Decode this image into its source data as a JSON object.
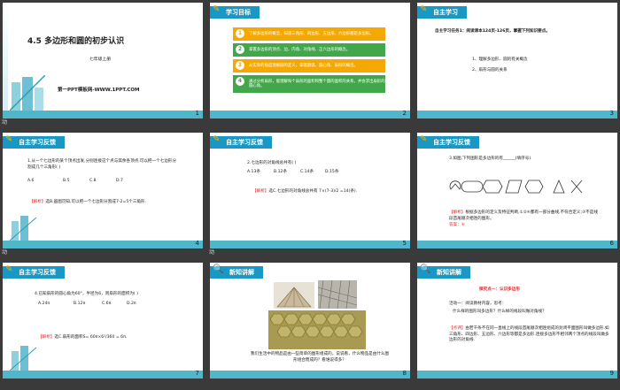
{
  "slides": [
    {
      "n": "1",
      "title": "4.5  多边形和圆的初步认识",
      "subtitle": "七年级上册",
      "credit": "第一PPT模板网-WWW.1PPT.COM"
    },
    {
      "n": "2",
      "header": "学习目标",
      "goals": [
        {
          "num": "1",
          "text": "了解多边形的概念，知道三角形、四边形、五边形、六边形都是多边形。",
          "color": "#f5a800"
        },
        {
          "num": "2",
          "text": "掌握多边形的顶点、边、内角、对角线、正六边形的概念。",
          "color": "#42a64a"
        },
        {
          "num": "3",
          "text": "从实际的角度理解圆的定义，掌握圆弧、圆心角、扇形的概念。",
          "color": "#f5a800"
        },
        {
          "num": "4",
          "text": "通过分析扇形，能理解每个扇形的面积和整个圆的面积的关系，并会求出扇形的圆心角。",
          "color": "#42a64a"
        }
      ]
    },
    {
      "n": "3",
      "header": "自主学习",
      "task": "自主学习任务1：阅读课本124页-126页，掌握下列知识要点。",
      "points": [
        "1、理解多边形、圆的有关概念",
        "2、扇形与圆的关系"
      ]
    },
    {
      "n": "4",
      "header": "自主学习反馈",
      "q": "1.从一个七边形的某个顶点出发,分别连接这个点与其余各顶点,可以把一个七边形分割成几个三角形(     )",
      "opts": [
        "A.6",
        "B.5",
        "C.8",
        "D.7"
      ],
      "ans_tag": "【解析】",
      "ans": "选B.画图可知,可以把一个七边形分割成7-2=5个三角形."
    },
    {
      "n": "5",
      "header": "自主学习反馈",
      "q": "2.七边形的对角线总共有(     )",
      "opts": [
        "A.13条",
        "B.12条",
        "C.14条",
        "D.15条"
      ],
      "ans_tag": "【解析】",
      "ans": "选C.七边形的对角线总共有 7×(7-3)/2 =14(条)."
    },
    {
      "n": "6",
      "header": "自主学习反馈",
      "q": "3.如图,下列图形是多边形的有______(填序号).",
      "ans_tag": "【解析】",
      "ans": "根据多边形的定义及特征判断,①②④都有一部分曲线,不符合定义;③不是线段首尾顺次相连的图形。",
      "ans2": "答案：⑥"
    },
    {
      "n": "7",
      "header": "自主学习反馈",
      "q": "4.已知扇形的圆心角为60°，半径为6，则扇形的面积为(     )",
      "opts": [
        "A.24π",
        "B.12π",
        "C.6π",
        "D.2π"
      ],
      "ans_tag": "【解析】",
      "ans": "选C.扇形的面积S= 60π×6²/360 = 6π."
    },
    {
      "n": "8",
      "header": "新知讲解",
      "caption": "我们生活中的物品是由一些简单的图形组成的，说说看，什么物品是由什么图形组合而成的？看谁说得多？"
    },
    {
      "n": "9",
      "header": "新知讲解",
      "activity": "探究点一：认识多边形",
      "a1": "活动一：阅读教材内容，思考：",
      "a1q": "什么样的图形叫多边形？什么样的线段叫做对角线？",
      "tag": "【点评】",
      "note": "由若干条不在同一直线上的线段首尾顺次相连组成的封闭平面图形叫做多边形.如三角形、四边形、五边形、六边形等都是多边形.连接多边形不相邻两个顶点的线段叫做多边形的对角线."
    }
  ],
  "side_labels": [
    "动",
    "动",
    "动"
  ]
}
